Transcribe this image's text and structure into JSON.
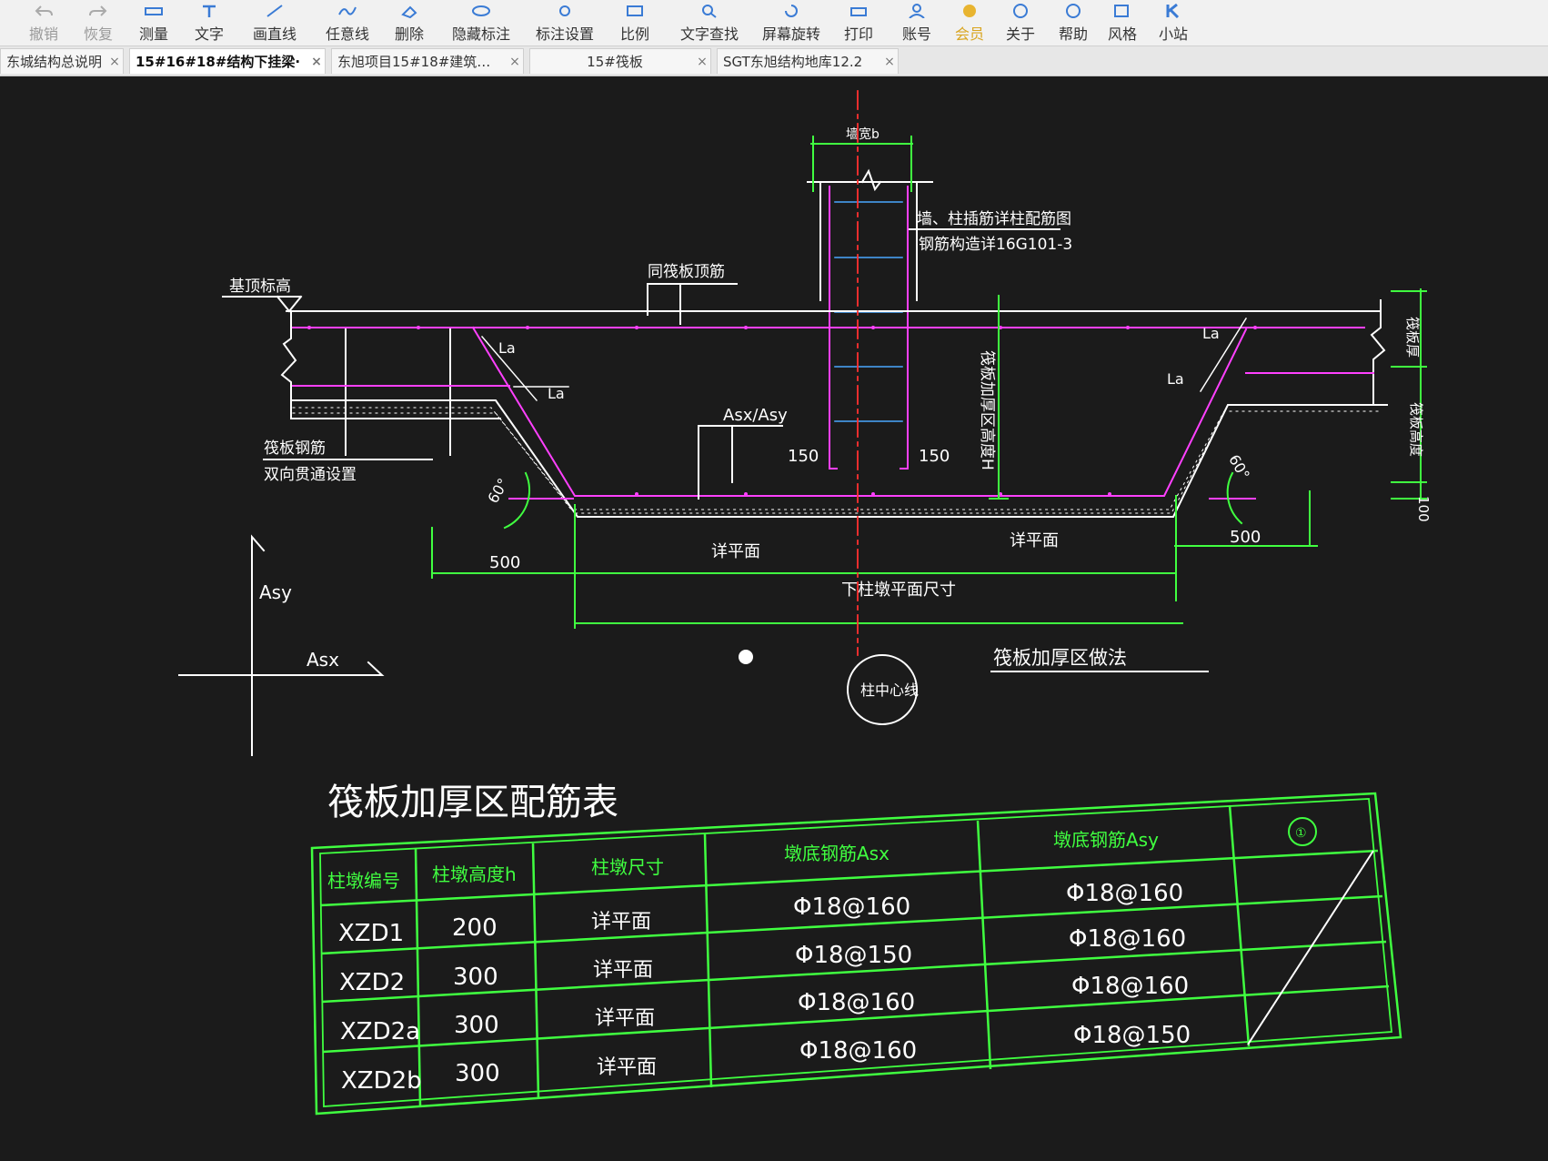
{
  "toolbar": {
    "items": [
      {
        "label": "撤销",
        "icon": "undo-icon"
      },
      {
        "label": "恢复",
        "icon": "redo-icon"
      },
      {
        "label": "测量",
        "icon": "measure-icon"
      },
      {
        "label": "文字",
        "icon": "text-icon"
      },
      {
        "label": "画直线",
        "icon": "line-icon"
      },
      {
        "label": "任意线",
        "icon": "freehand-icon"
      },
      {
        "label": "删除",
        "icon": "delete-icon"
      },
      {
        "label": "隐藏标注",
        "icon": "hide-annotation-icon"
      },
      {
        "label": "标注设置",
        "icon": "annotation-settings-icon"
      },
      {
        "label": "比例",
        "icon": "scale-icon"
      },
      {
        "label": "文字查找",
        "icon": "text-search-icon"
      },
      {
        "label": "屏幕旋转",
        "icon": "rotate-screen-icon"
      },
      {
        "label": "打印",
        "icon": "print-icon"
      },
      {
        "label": "账号",
        "icon": "account-icon"
      },
      {
        "label": "会员",
        "icon": "vip-icon"
      },
      {
        "label": "关于",
        "icon": "info-icon"
      },
      {
        "label": "帮助",
        "icon": "help-icon"
      },
      {
        "label": "风格",
        "icon": "style-icon"
      },
      {
        "label": "小站",
        "icon": "station-icon"
      }
    ]
  },
  "tabs": [
    {
      "label": "东城结构总说明",
      "active": false
    },
    {
      "label": "15#16#18#结构下挂梁·",
      "active": true
    },
    {
      "label": "东旭项目15#18#建筑…",
      "active": false
    },
    {
      "label": "15#筏板",
      "active": false
    },
    {
      "label": "SGT东旭结构地库12.2",
      "active": false
    }
  ],
  "tab_close": "×",
  "drawing": {
    "labels": {
      "wall_width": "墙宽b",
      "wall_note_1": "墙、柱插筋详柱配筋图",
      "wall_note_2": "钢筋构造详16G101-3",
      "top_elev": "基顶标高",
      "same_top": "同筏板顶筋",
      "la1": "La",
      "la2": "La",
      "la3": "La",
      "la4": "La",
      "asx_asy": "Asx/Asy",
      "dim150a": "150",
      "dim150b": "150",
      "raft_note_1": "筏板钢筋",
      "raft_note_2": "双向贯通设置",
      "angle_left": "60°",
      "angle_right": "60°",
      "thick_label": "筏板加厚区高度H",
      "raft_thick": "筏板厚",
      "raft_height": "筏板高度",
      "dim100": "100",
      "dim500a": "500",
      "dim500b": "500",
      "plan_a": "详平面",
      "plan_b": "详平面",
      "pier_size": "下柱墩平面尺寸",
      "axis_asy": "Asy",
      "axis_asx": "Asx",
      "center": "柱中心线",
      "detail_title": "筏板加厚区做法"
    },
    "colors": {
      "concrete": "#ffffff",
      "rebar": "#ff40ff",
      "dim": "#40ff40",
      "center": "#ff3030",
      "blue": "#4aa8ff",
      "table": "#40ff40"
    }
  },
  "table": {
    "title": "筏板加厚区配筋表",
    "headers": [
      "柱墩编号",
      "柱墩高度h",
      "柱墩尺寸",
      "墩底钢筋Asx",
      "墩底钢筋Asy",
      "①"
    ],
    "rows": [
      [
        "XZD1",
        "200",
        "详平面",
        "Φ18@160",
        "Φ18@160"
      ],
      [
        "XZD2",
        "300",
        "详平面",
        "Φ18@150",
        "Φ18@160"
      ],
      [
        "XZD2a",
        "300",
        "详平面",
        "Φ18@160",
        "Φ18@160"
      ],
      [
        "XZD2b",
        "300",
        "详平面",
        "Φ18@160",
        "Φ18@150"
      ]
    ]
  }
}
